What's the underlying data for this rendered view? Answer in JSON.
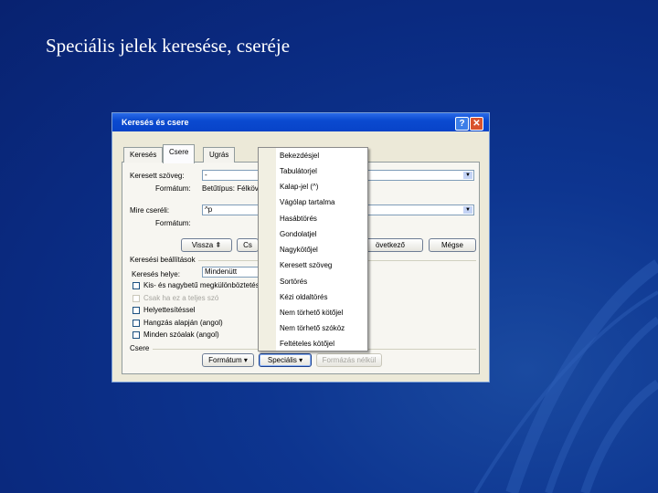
{
  "slide": {
    "title": "Speciális jelek keresése, cseréje"
  },
  "dialog": {
    "title": "Keresés és csere",
    "help_button": "?",
    "close_button": "✕",
    "tabs": [
      "Keresés",
      "Csere",
      "Ugrás"
    ],
    "active_tab": "Csere",
    "find": {
      "label": "Keresett szöveg:",
      "value": "-",
      "format_label": "Formátum:",
      "format_value": "Betűtípus: Félköv"
    },
    "replace": {
      "label": "Mire cseréli:",
      "value": "^p",
      "format_label": "Formátum:"
    },
    "buttons": {
      "less": "Vissza ⇞",
      "replace": "Cs",
      "find_next": "övetkező",
      "cancel": "Mégse",
      "format": "Formátum ▾",
      "special": "Speciális ▾",
      "no_formatting": "Formázás nélkül"
    },
    "search_options": {
      "title": "Keresési beállítások",
      "search_label": "Keresés helye:",
      "search_value": "Mindenütt",
      "options": [
        {
          "label": "Kis- és nagybetű megkülönböztetés",
          "checked": false,
          "disabled": false
        },
        {
          "label": "Csak ha ez a teljes szó",
          "checked": false,
          "disabled": true
        },
        {
          "label": "Helyettesítéssel",
          "checked": false,
          "disabled": false
        },
        {
          "label": "Hangzás alapján (angol)",
          "checked": false,
          "disabled": false
        },
        {
          "label": "Minden szóalak (angol)",
          "checked": false,
          "disabled": false
        }
      ]
    },
    "replace_section_title": "Csere"
  },
  "special_menu": {
    "items": [
      "Bekezdésjel",
      "Tabulátorjel",
      "Kalap-jel (^)",
      "Vágólap tartalma",
      "Hasábtörés",
      "Gondolatjel",
      "Nagykötőjel",
      "Keresett szöveg",
      "Sortörés",
      "Kézi oldaltörés",
      "Nem törhető kötőjel",
      "Nem törhető szóköz",
      "Feltételes kötőjel"
    ]
  },
  "colors": {
    "background": "#0a2a80",
    "titlebar": "#0a4ad0",
    "dialog_face": "#ece9d8"
  }
}
